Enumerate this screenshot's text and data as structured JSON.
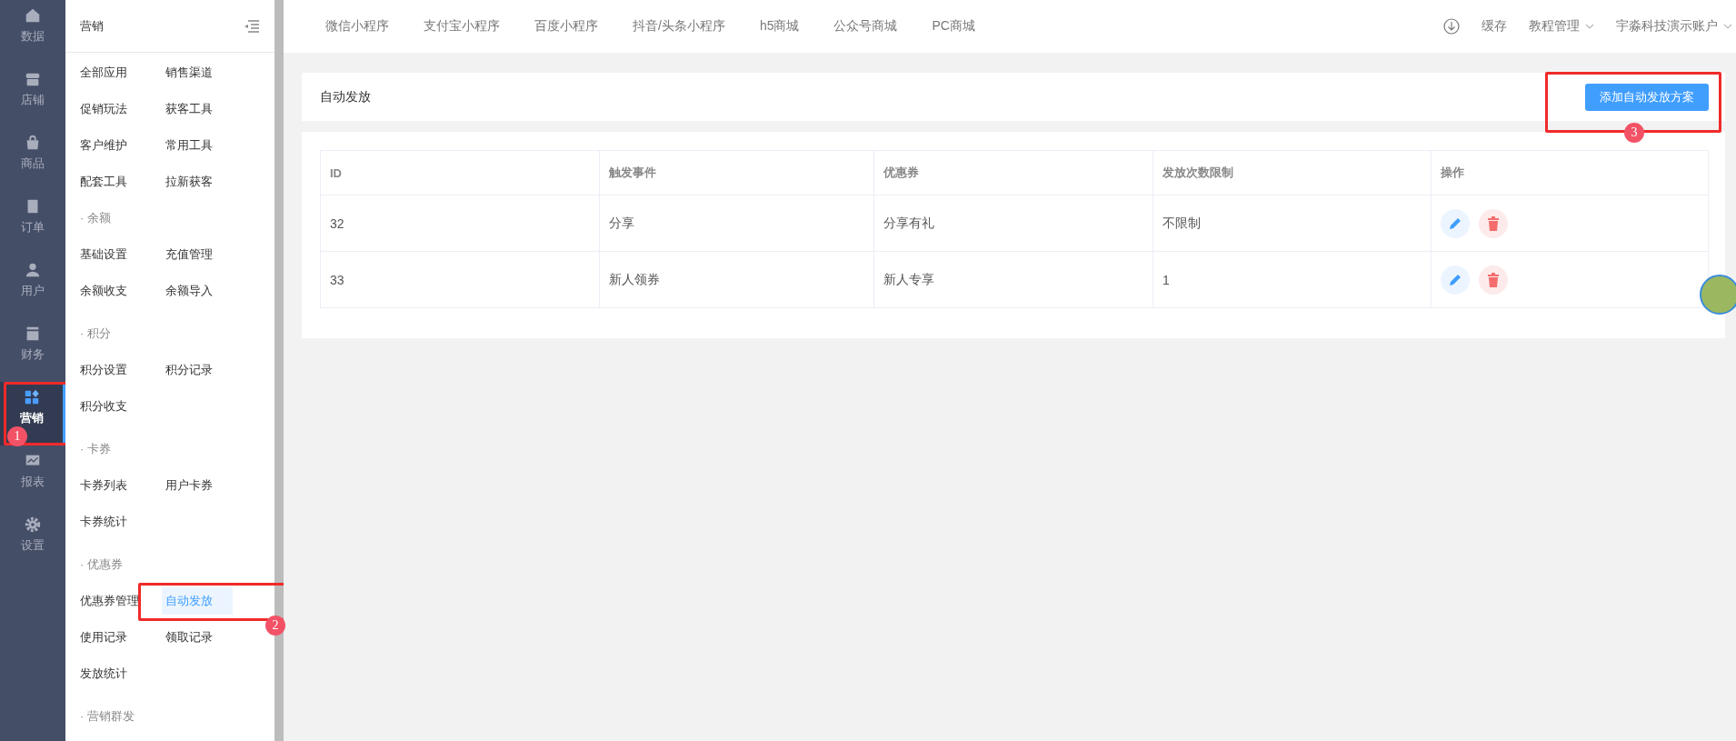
{
  "nav_rail": {
    "items": [
      {
        "label": "数据",
        "selected": false
      },
      {
        "label": "店铺",
        "selected": false
      },
      {
        "label": "商品",
        "selected": false
      },
      {
        "label": "订单",
        "selected": false
      },
      {
        "label": "用户",
        "selected": false
      },
      {
        "label": "财务",
        "selected": false
      },
      {
        "label": "营销",
        "selected": true,
        "annotation": "1"
      },
      {
        "label": "报表",
        "selected": false
      },
      {
        "label": "设置",
        "selected": false
      }
    ]
  },
  "submenu": {
    "title": "营销",
    "groups": [
      {
        "items": [
          {
            "label": "全部应用",
            "selected": false
          },
          {
            "label": "销售渠道",
            "selected": false
          },
          {
            "label": "促销玩法",
            "selected": false
          },
          {
            "label": "获客工具",
            "selected": false
          },
          {
            "label": "客户维护",
            "selected": false
          },
          {
            "label": "常用工具",
            "selected": false
          },
          {
            "label": "配套工具",
            "selected": false
          },
          {
            "label": "拉新获客",
            "selected": false
          }
        ]
      },
      {
        "heading": "· 余额",
        "items": [
          {
            "label": "基础设置",
            "selected": false
          },
          {
            "label": "充值管理",
            "selected": false
          },
          {
            "label": "余额收支",
            "selected": false
          },
          {
            "label": "余额导入",
            "selected": false
          }
        ]
      },
      {
        "heading": "· 积分",
        "items": [
          {
            "label": "积分设置",
            "selected": false
          },
          {
            "label": "积分记录",
            "selected": false
          },
          {
            "label": "积分收支",
            "selected": false
          }
        ]
      },
      {
        "heading": "· 卡券",
        "items": [
          {
            "label": "卡券列表",
            "selected": false
          },
          {
            "label": "用户卡券",
            "selected": false
          },
          {
            "label": "卡券统计",
            "selected": false
          }
        ]
      },
      {
        "heading": "· 优惠券",
        "items": [
          {
            "label": "优惠券管理",
            "selected": false
          },
          {
            "label": "自动发放",
            "selected": true,
            "annotation": "2"
          },
          {
            "label": "使用记录",
            "selected": false
          },
          {
            "label": "领取记录",
            "selected": false
          },
          {
            "label": "发放统计",
            "selected": false
          }
        ]
      },
      {
        "heading": "· 营销群发"
      }
    ]
  },
  "top_tabs": [
    "微信小程序",
    "支付宝小程序",
    "百度小程序",
    "抖音/头条小程序",
    "h5商城",
    "公众号商城",
    "PC商城"
  ],
  "top_right": {
    "cache": "缓存",
    "menus": [
      "教程管理",
      "宇淼科技演示账户"
    ]
  },
  "page": {
    "title": "自动发放",
    "add_button": {
      "label": "添加自动发放方案",
      "annotation": "3"
    }
  },
  "table": {
    "columns": [
      "ID",
      "触发事件",
      "优惠券",
      "发放次数限制",
      "操作"
    ],
    "rows": [
      {
        "id": "32",
        "event": "分享",
        "coupon": "分享有礼",
        "limit": "不限制"
      },
      {
        "id": "33",
        "event": "新人领券",
        "coupon": "新人专享",
        "limit": "1"
      }
    ]
  }
}
